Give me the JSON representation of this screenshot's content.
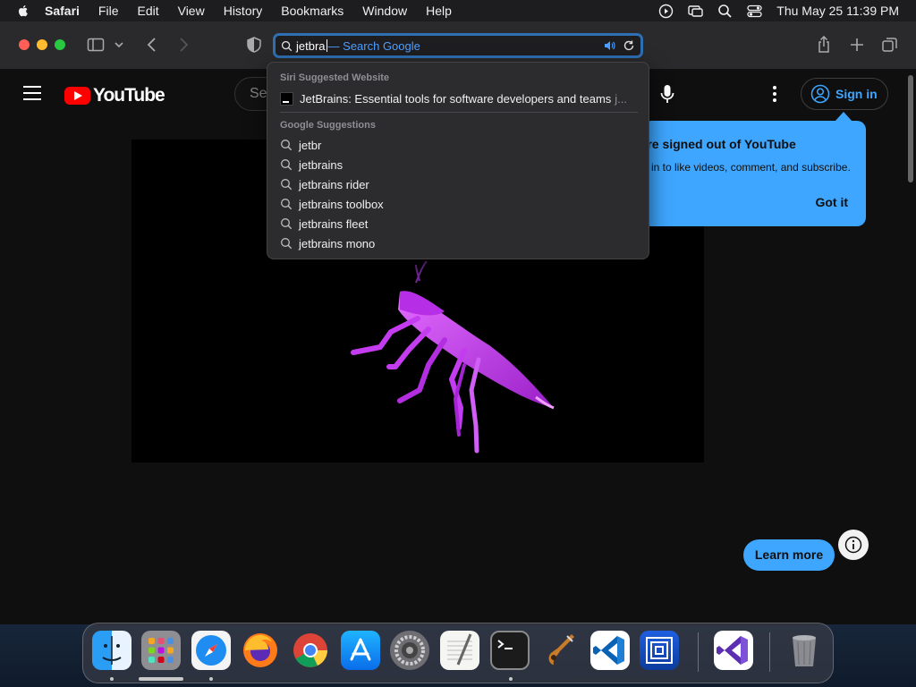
{
  "menubar": {
    "app_name": "Safari",
    "items": [
      "File",
      "Edit",
      "View",
      "History",
      "Bookmarks",
      "Window",
      "Help"
    ],
    "datetime": "Thu May 25  11:39 PM"
  },
  "address_bar": {
    "typed": "jetbra",
    "suggestion": "— Search Google"
  },
  "dropdown": {
    "siri_header": "Siri Suggested Website",
    "siri_site_title": "JetBrains: Essential tools for software developers and teams",
    "siri_site_url": "j...",
    "google_header": "Google Suggestions",
    "suggestions": [
      "jetbr",
      "jetbrains",
      "jetbrains rider",
      "jetbrains toolbox",
      "jetbrains fleet",
      "jetbrains mono"
    ]
  },
  "youtube": {
    "logo_text": "YouTube",
    "search_placeholder": "Se",
    "sign_in": "Sign in",
    "tooltip_title": "'re signed out of YouTube",
    "tooltip_body": "in to like videos, comment, and subscribe.",
    "tooltip_button": "Got it",
    "learn_more": "Learn more"
  },
  "colors": {
    "accent_blue": "#3ea6ff",
    "address_focus": "#2f6fb3",
    "insect": "#c43cf0",
    "youtube_red": "#ff0000"
  },
  "dock": {
    "apps": [
      "finder-icon",
      "launchpad-icon",
      "safari-icon",
      "firefox-icon",
      "chrome-icon",
      "app-store-icon",
      "system-settings-icon",
      "textedit-icon",
      "terminal-icon",
      "garageband-icon",
      "vscode-icon",
      "proxy-app-icon",
      "visual-studio-icon",
      "trash-icon"
    ]
  }
}
